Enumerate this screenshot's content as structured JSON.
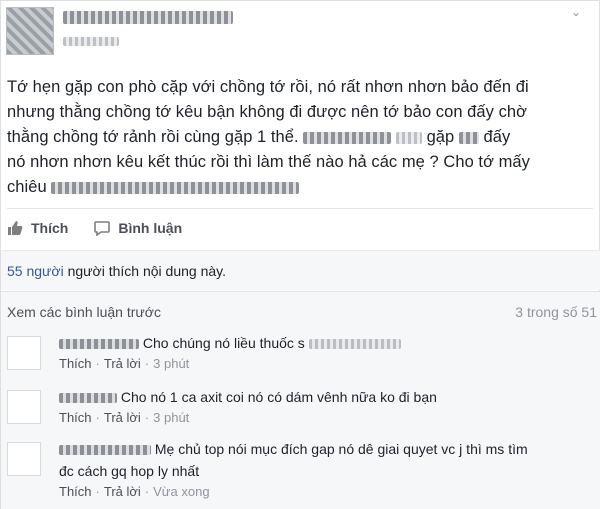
{
  "post": {
    "paragraph": {
      "line1": "Tớ hẹn gặp con phò cặp với chồng tớ rồi, nó rất nhơn nhơn bảo đến đi",
      "line2": "nhưng thằng chồng tớ kêu bận không đi được nên tớ bảo con đấy chờ",
      "line3_a": "thằng chồng tớ rảnh rồi cùng gặp 1 thể.",
      "line3_b": "gặp",
      "line3_c": "đấy",
      "line4": "nó nhơn nhơn kêu kết thúc rồi thì làm thế nào hả các mẹ ? Cho tớ mấy",
      "line5": "chiêu"
    }
  },
  "actions": {
    "like_label": "Thích",
    "comment_label": "Bình luận"
  },
  "likes": {
    "count_text": "55 người",
    "suffix": " người thích nội dung này."
  },
  "comments": {
    "view_previous": "Xem các bình luận trước",
    "count": "3 trong số 51",
    "items": [
      {
        "text": "Cho chúng nó liều thuốc s",
        "like": "Thích",
        "reply": "Trả lời",
        "time": "3 phút"
      },
      {
        "text": "Cho nó 1 ca axit coi nó có dám vênh nữa ko đi bạn",
        "like": "Thích",
        "reply": "Trả lời",
        "time": "3 phút"
      },
      {
        "text": "Mẹ chủ top nói mục đích gap nó dê giai quyet vc j thì ms tìm",
        "text2": "đc cách gq hop ly nhất",
        "like": "Thích",
        "reply": "Trả lời",
        "time": "Vừa xong"
      }
    ]
  },
  "colors": {
    "link": "#365899",
    "muted": "#90949c",
    "panel": "#f6f7f9"
  },
  "icons": {
    "like": "thumbs-up-icon",
    "comment": "comment-bubble-icon",
    "menu": "chevron-down-icon"
  }
}
